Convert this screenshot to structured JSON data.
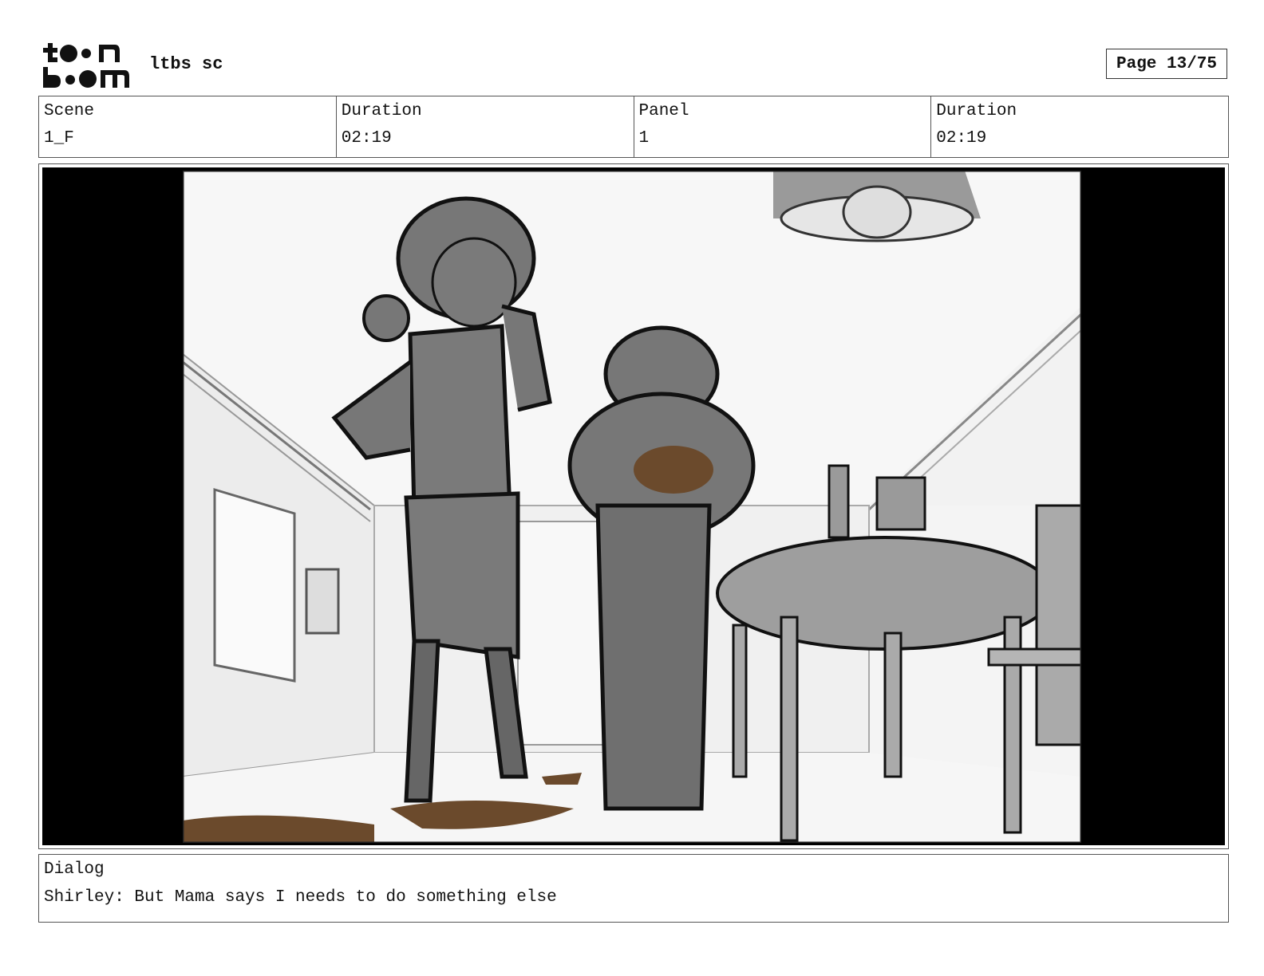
{
  "header": {
    "logo_text": "toon boom",
    "project_name": "ltbs sc",
    "page_label": "Page 13/75"
  },
  "info": {
    "scene_label": "Scene",
    "scene_value": "1_F",
    "scene_duration_label": "Duration",
    "scene_duration_value": "02:19",
    "panel_label": "Panel",
    "panel_value": "1",
    "panel_duration_label": "Duration",
    "panel_duration_value": "02:19"
  },
  "dialog": {
    "label": "Dialog",
    "text": "Shirley: But Mama says I needs to do something else"
  }
}
